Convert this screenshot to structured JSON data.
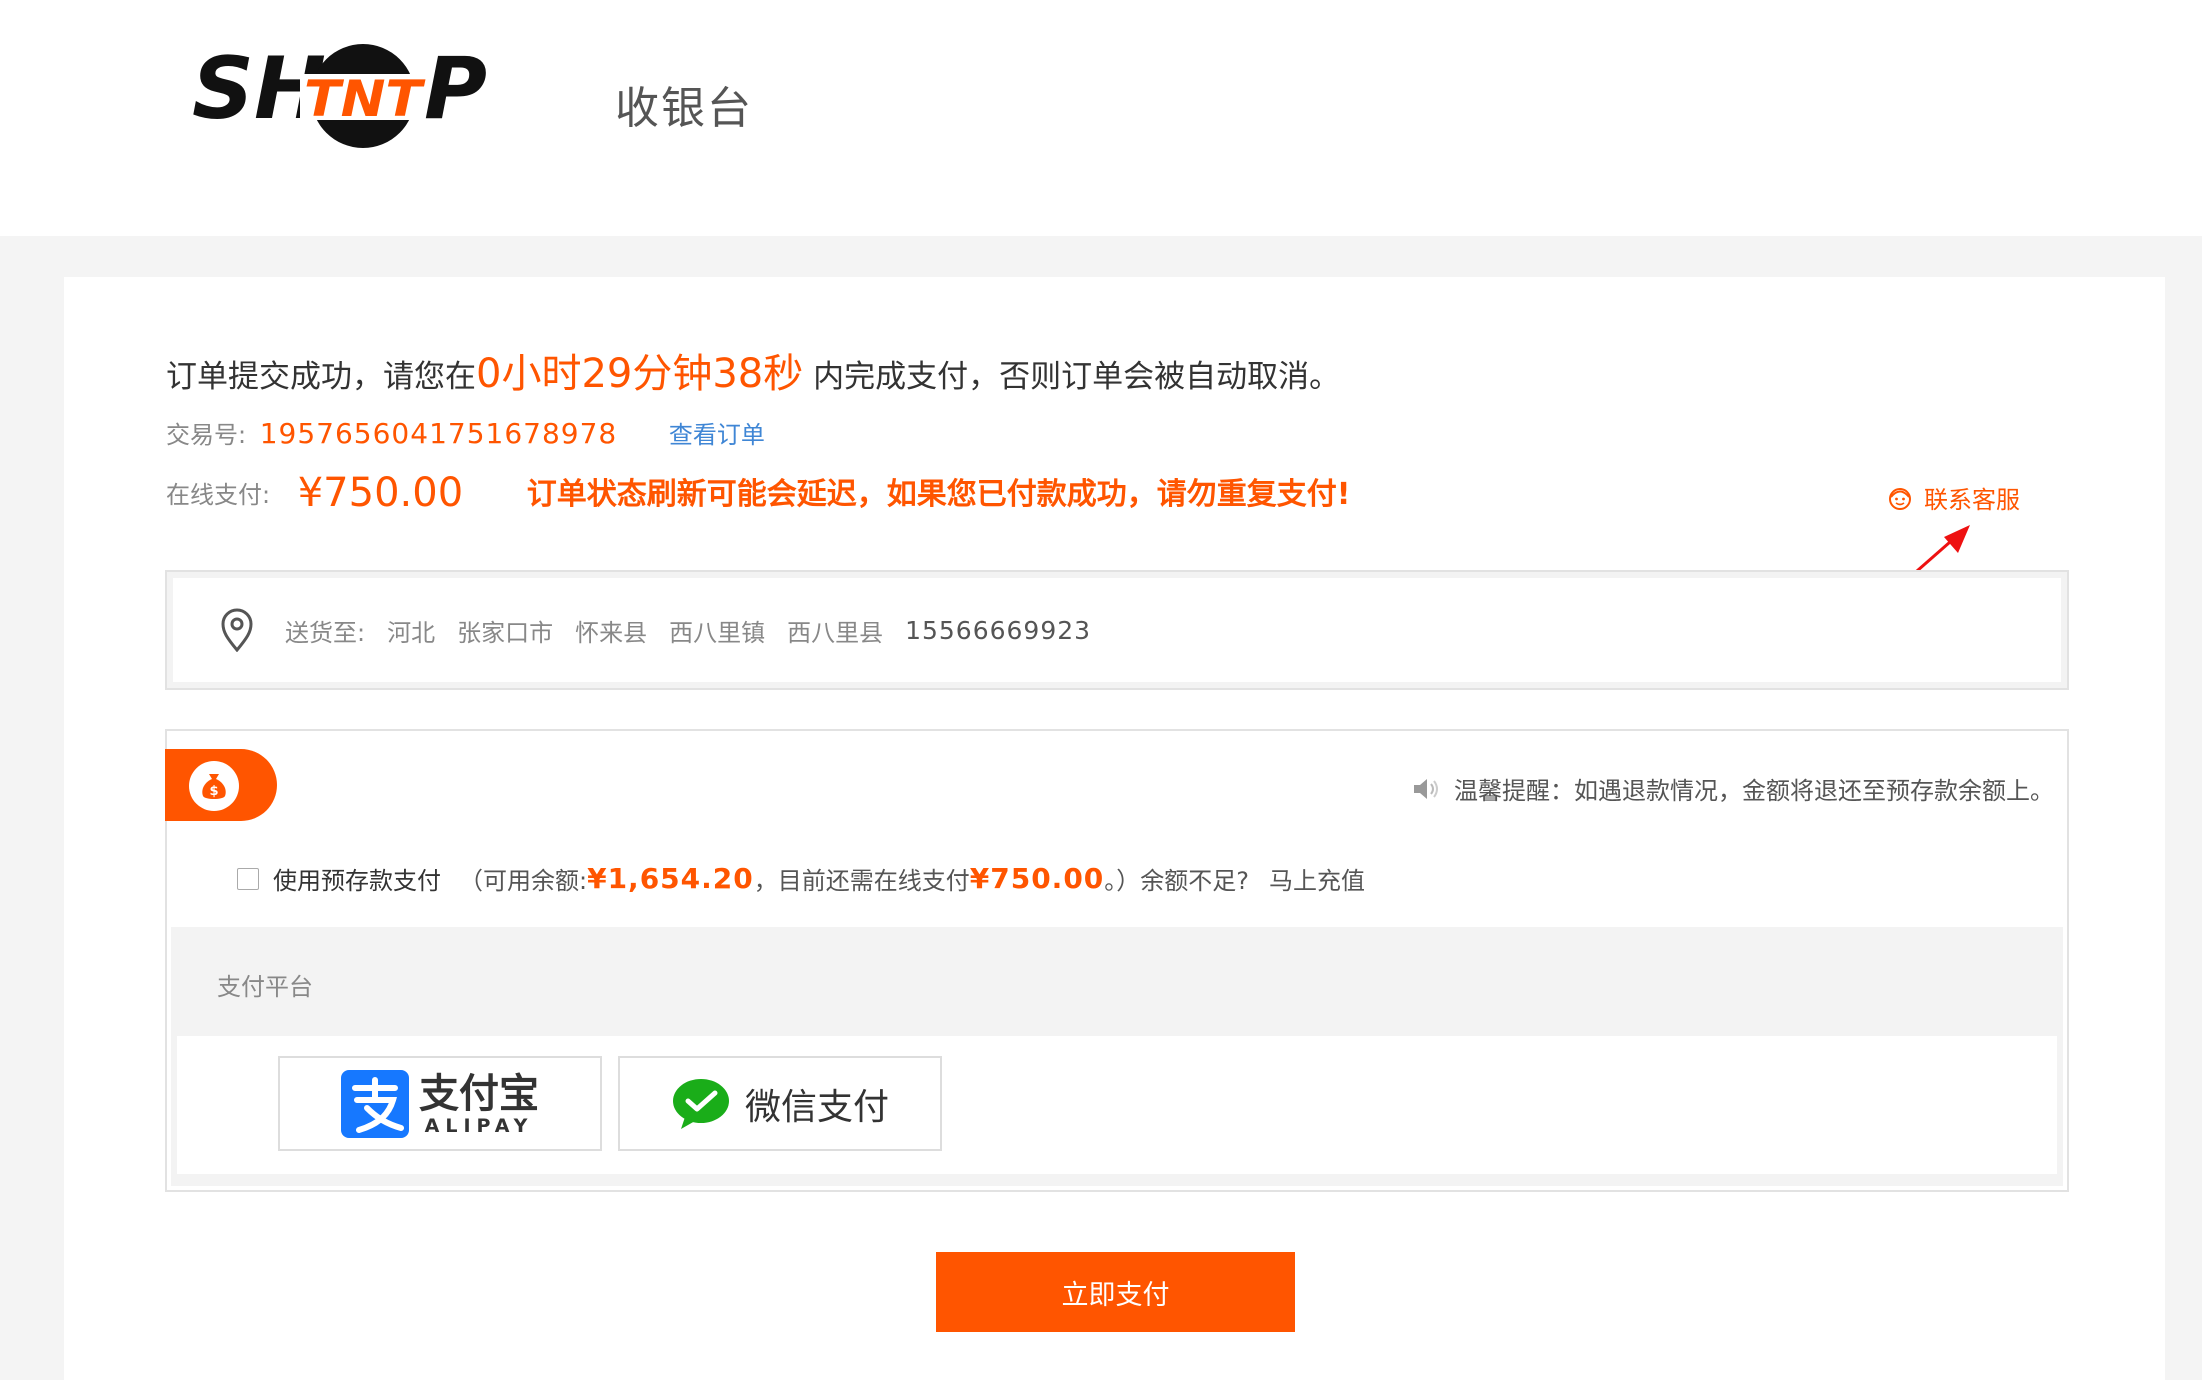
{
  "header": {
    "logo_text": "SHTNTP",
    "title": "收银台"
  },
  "order": {
    "success_prefix": "订单提交成功，请您在",
    "countdown": "0小时29分钟38秒",
    "success_suffix": " 内完成支付，否则订单会被自动取消。",
    "trade_label": "交易号:",
    "trade_no": "1957656041751678978",
    "view_order": "查看订单",
    "online_pay_label": "在线支付:",
    "amount": "¥750.00",
    "delay_warning": "订单状态刷新可能会延迟，如果您已付款成功，请勿重复支付!",
    "contact_service": "联系客服"
  },
  "address": {
    "label": "送货至:",
    "province": "河北",
    "city": "张家口市",
    "county": "怀来县",
    "town": "西八里镇",
    "detail": "西八里县",
    "phone": "15566669923",
    "icon": "location-pin-icon"
  },
  "payment": {
    "tip": "温馨提醒：如遇退款情况，金额将退还至预存款余额上。",
    "prepay": {
      "label": "使用预存款支付",
      "open": "（可用余额:",
      "balance": "¥1,654.20",
      "middle": "，目前还需在线支付",
      "need": "¥750.00",
      "close": "。）余额不足?",
      "recharge": "马上充值",
      "checked": false
    },
    "platform_label": "支付平台",
    "alipay": {
      "cn": "支付宝",
      "en": "ALIPAY",
      "icon": "alipay-icon"
    },
    "wechat": {
      "label": "微信支付",
      "icon": "wechat-pay-icon"
    },
    "pay_now": "立即支付"
  },
  "colors": {
    "accent": "#ff5500",
    "link": "#3f86d5",
    "alipay_blue": "#1678ff",
    "wechat_green": "#1aad19"
  }
}
